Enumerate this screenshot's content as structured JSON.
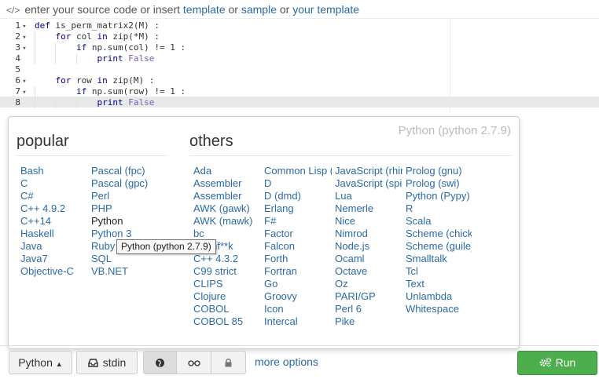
{
  "topbar": {
    "icon": "code-icon",
    "prefix": "enter your source code or insert",
    "link_template": "template",
    "or1": "or",
    "link_sample": "sample",
    "or2": "or",
    "link_your_template": "your template"
  },
  "editor": {
    "lines": [
      {
        "num": "1",
        "fold": "▾",
        "code": "def is_perm_matrix2(M) :"
      },
      {
        "num": "2",
        "fold": "▾",
        "code": "    for col in zip(*M) :"
      },
      {
        "num": "3",
        "fold": "▾",
        "code": "        if np.sum(col) != 1 :"
      },
      {
        "num": "4",
        "fold": "",
        "code": "            print False"
      },
      {
        "num": "5",
        "fold": "",
        "code": ""
      },
      {
        "num": "6",
        "fold": "▾",
        "code": "    for row in zip(M) :"
      },
      {
        "num": "7",
        "fold": "▾",
        "code": "        if np.sum(row) != 1 :"
      },
      {
        "num": "8",
        "fold": "",
        "code": "            print False"
      }
    ]
  },
  "language_panel": {
    "current": "Python (python 2.7.9)",
    "popular_heading": "popular",
    "others_heading": "others",
    "popular_col1": [
      "Bash",
      "C",
      "C#",
      "C++ 4.9.2",
      "C++14",
      "Haskell",
      "Java",
      "Java7",
      "Objective-C"
    ],
    "popular_col2": [
      "Pascal (fpc)",
      "Pascal (gpc)",
      "Perl",
      "PHP",
      "Python",
      "Python 3",
      "Ruby",
      "SQL",
      "VB.NET"
    ],
    "others_col1": [
      "Ada",
      "Assembler",
      "Assembler",
      "AWK (gawk)",
      "AWK (mawk)",
      "bc",
      "Brainf**k",
      "C++ 4.3.2",
      "C99 strict",
      "CLIPS",
      "Clojure",
      "COBOL",
      "COBOL 85"
    ],
    "others_col2": [
      "Common Lisp (clisp)",
      "D",
      "D (dmd)",
      "Erlang",
      "F#",
      "Factor",
      "Falcon",
      "Forth",
      "Fortran",
      "Go",
      "Groovy",
      "Icon",
      "Intercal"
    ],
    "others_col3": [
      "JavaScript (rhino)",
      "JavaScript (spidermonkey)",
      "Lua",
      "Nemerle",
      "Nice",
      "Nimrod",
      "Node.js",
      "Ocaml",
      "Octave",
      "Oz",
      "PARI/GP",
      "Perl 6",
      "Pike"
    ],
    "others_col4": [
      "Prolog (gnu)",
      "Prolog (swi)",
      "Python (Pypy)",
      "R",
      "Scala",
      "Scheme (chicken)",
      "Scheme (guile)",
      "Smalltalk",
      "Tcl",
      "Text",
      "Unlambda",
      "Whitespace"
    ],
    "tooltip": "Python (python 2.7.9)"
  },
  "toolbar": {
    "language_label": "Python",
    "language_caret": "▲",
    "stdin_label": "stdin",
    "more_options": "more options",
    "run_label": "Run"
  },
  "colors": {
    "link": "#2a6aa5",
    "run_button": "#4cae4c"
  }
}
